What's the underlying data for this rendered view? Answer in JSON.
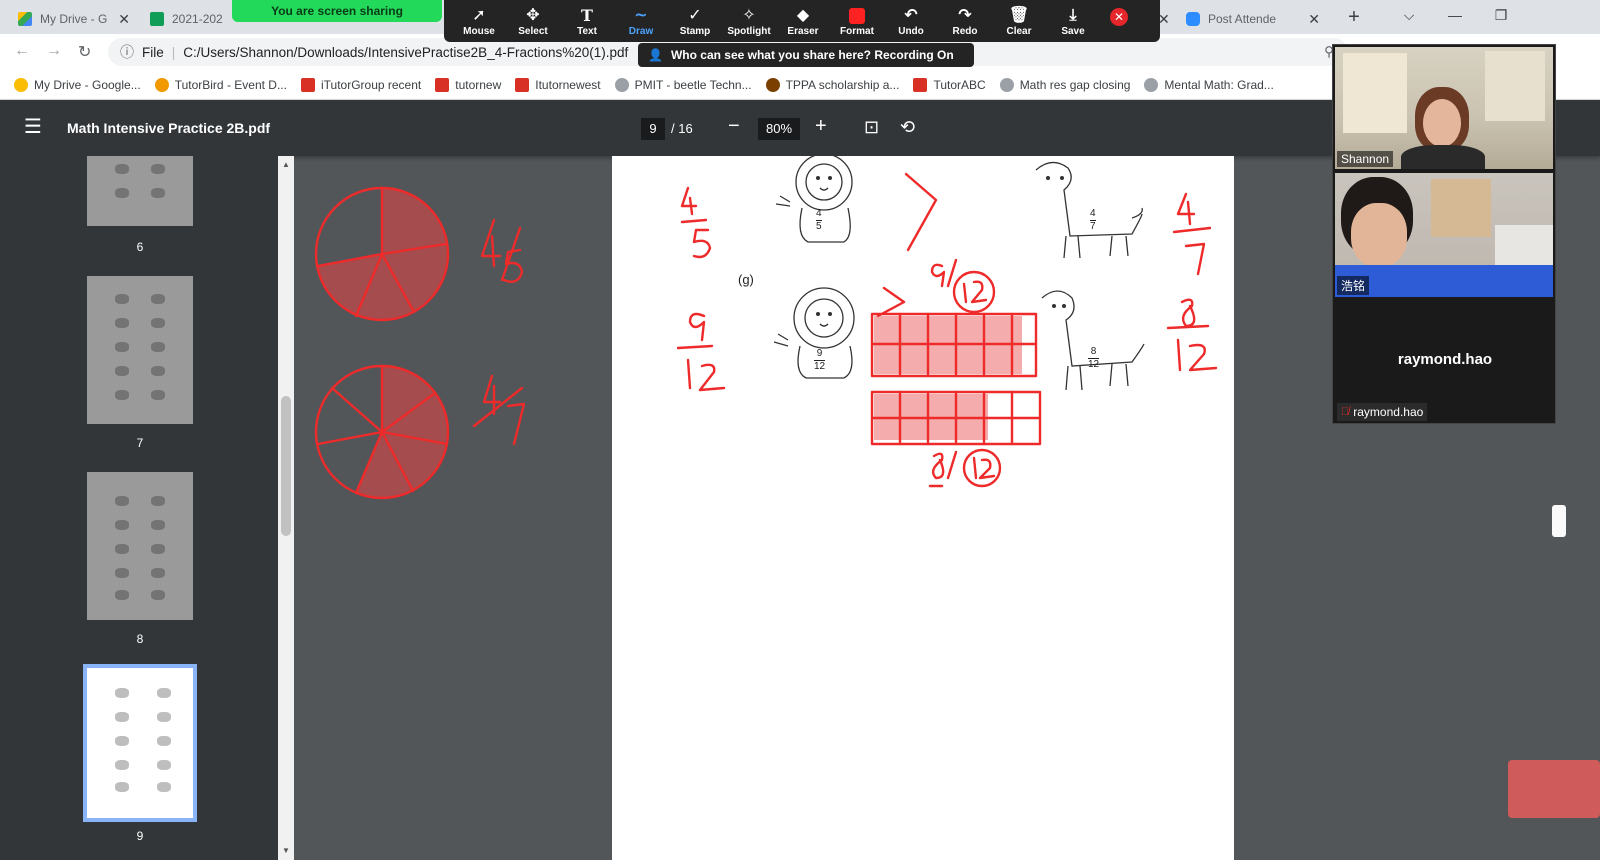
{
  "browser": {
    "tabs": [
      {
        "label": "My Drive - G",
        "color": "#1a73e8"
      },
      {
        "label": "2021-202",
        "color": "#0f9d58"
      },
      {
        "label": "Post Attende",
        "color": "#2d8cff"
      }
    ]
  },
  "share_banner": "You are screen sharing",
  "annotate_toolbar": {
    "tools": [
      "Mouse",
      "Select",
      "Text",
      "Draw",
      "Stamp",
      "Spotlight",
      "Eraser",
      "Format",
      "Undo",
      "Redo",
      "Clear",
      "Save"
    ],
    "selected": "Draw",
    "notice": "Who can see what you share here? Recording On"
  },
  "address": {
    "scheme": "File",
    "path": "C:/Users/Shannon/Downloads/IntensivePractise2B_4-Fractions%20(1).pdf"
  },
  "bookmarks": [
    {
      "label": "My Drive - Google...",
      "color": "#fbbc04"
    },
    {
      "label": "TutorBird - Event D...",
      "color": "#f29900"
    },
    {
      "label": "iTutorGroup recent",
      "color": "#d93025"
    },
    {
      "label": "tutornew",
      "color": "#d93025"
    },
    {
      "label": "Itutornewest",
      "color": "#d93025"
    },
    {
      "label": "PMIT - beetle Techn...",
      "color": "#9aa0a6"
    },
    {
      "label": "TPPA scholarship a...",
      "color": "#7b3f00"
    },
    {
      "label": "TutorABC",
      "color": "#d93025"
    },
    {
      "label": "Math res gap closing",
      "color": "#9aa0a6"
    },
    {
      "label": "Mental Math: Grad...",
      "color": "#9aa0a6"
    }
  ],
  "pdf": {
    "title": "Math Intensive Practice 2B.pdf",
    "page": "9",
    "total": "/ 16",
    "zoom": "80%"
  },
  "thumbnails": [
    "6",
    "7",
    "8",
    "9"
  ],
  "worksheet": {
    "item_label": "(g)",
    "lion_f_fraction": [
      "4",
      "5"
    ],
    "giraffe_f_fraction": [
      "4",
      "7"
    ],
    "lion_g_fraction": [
      "9",
      "12"
    ],
    "giraffe_g_fraction": [
      "8",
      "12"
    ]
  },
  "participants": [
    {
      "name": "Shannon"
    },
    {
      "name": "浩铭"
    },
    {
      "name": "raymond.hao"
    }
  ]
}
